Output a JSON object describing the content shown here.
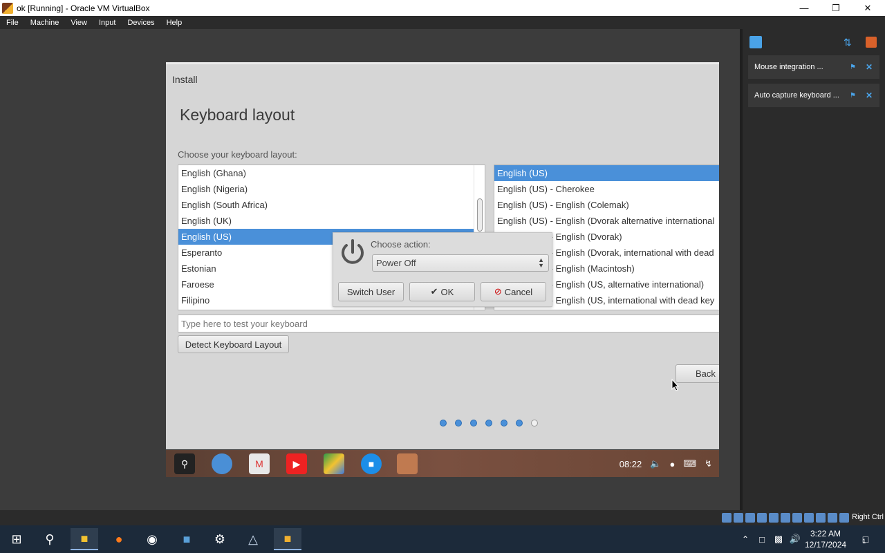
{
  "window": {
    "title": "ok [Running] - Oracle VM VirtualBox"
  },
  "menu": [
    "File",
    "Machine",
    "View",
    "Input",
    "Devices",
    "Help"
  ],
  "installer": {
    "window_label": "Install",
    "heading": "Keyboard layout",
    "choose_label": "Choose your keyboard layout:",
    "layouts": [
      "English (Ghana)",
      "English (Nigeria)",
      "English (South Africa)",
      "English (UK)",
      "English (US)",
      "Esperanto",
      "Estonian",
      "Faroese",
      "Filipino"
    ],
    "selected_layout": "English (US)",
    "variants": [
      "English (US)",
      "English (US) - Cherokee",
      "English (US) - English (Colemak)",
      "English (US) - English (Dvorak alternative international",
      "English (US) - English (Dvorak)",
      "English (US) - English (Dvorak, international with dead",
      "English (US) - English (Macintosh)",
      "English (US) - English (US, alternative international)",
      "English (US) - English (US, international with dead key"
    ],
    "selected_variant": "English (US)",
    "test_placeholder": "Type here to test your keyboard",
    "detect_button": "Detect Keyboard Layout",
    "back_button": "Back",
    "progress_steps": 7,
    "progress_current": 6
  },
  "power_dialog": {
    "label": "Choose action:",
    "selected": "Power Off",
    "switch_user": "Switch User",
    "ok": "OK",
    "cancel": "Cancel"
  },
  "guest_taskbar": {
    "time": "08:22"
  },
  "notifications": [
    {
      "text": "Mouse integration ..."
    },
    {
      "text": "Auto capture keyboard ..."
    }
  ],
  "statusbar": {
    "host_key": "Right Ctrl"
  },
  "taskbar": {
    "time": "3:22 AM",
    "date": "12/17/2024",
    "notif_count": "1"
  },
  "colors": {
    "selection": "#4a90d9",
    "accent": "#4aa3e8"
  }
}
